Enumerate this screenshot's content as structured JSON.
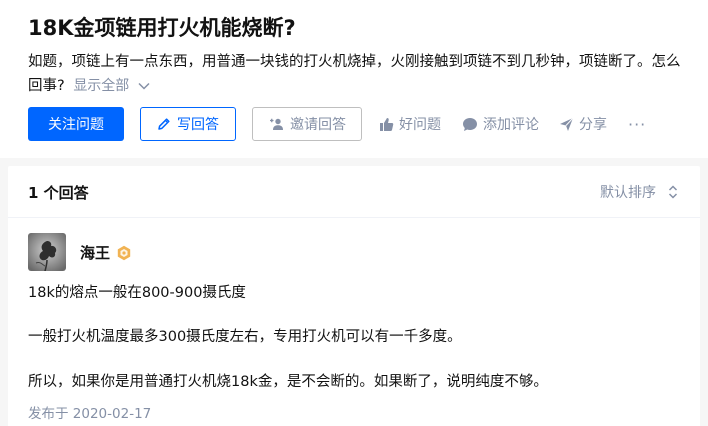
{
  "question": {
    "title": "18K金项链用打火机能烧断?",
    "detail": "如题，项链上有一点东西，用普通一块钱的打火机烧掉，火刚接触到项链不到几秒钟，项链断了。怎么回事?",
    "show_all": "显示全部"
  },
  "actions": {
    "follow": "关注问题",
    "write_answer": "写回答",
    "invite": "邀请回答",
    "good_question": "好问题",
    "add_comment": "添加评论",
    "share": "分享",
    "more": "···"
  },
  "answers": {
    "count_label": "1 个回答",
    "sort_label": "默认排序"
  },
  "answer": {
    "author": "海王",
    "paragraphs": [
      "18k的熔点一般在800-900摄氏度",
      "一般打火机温度最多300摄氏度左右，专用打火机可以有一千多度。",
      "所以，如果你是用普通打火机烧18k金，是不会断的。如果断了，说明纯度不够。"
    ],
    "published": "发布于 2020-02-17"
  },
  "colors": {
    "brand": "#0066ff",
    "muted": "#8590a6",
    "badge": "#f1b353"
  },
  "icons": [
    "pen-icon",
    "invite-icon",
    "thumb-up-icon",
    "comment-icon",
    "share-icon",
    "sort-icon",
    "chevron-down-icon",
    "badge-icon"
  ]
}
